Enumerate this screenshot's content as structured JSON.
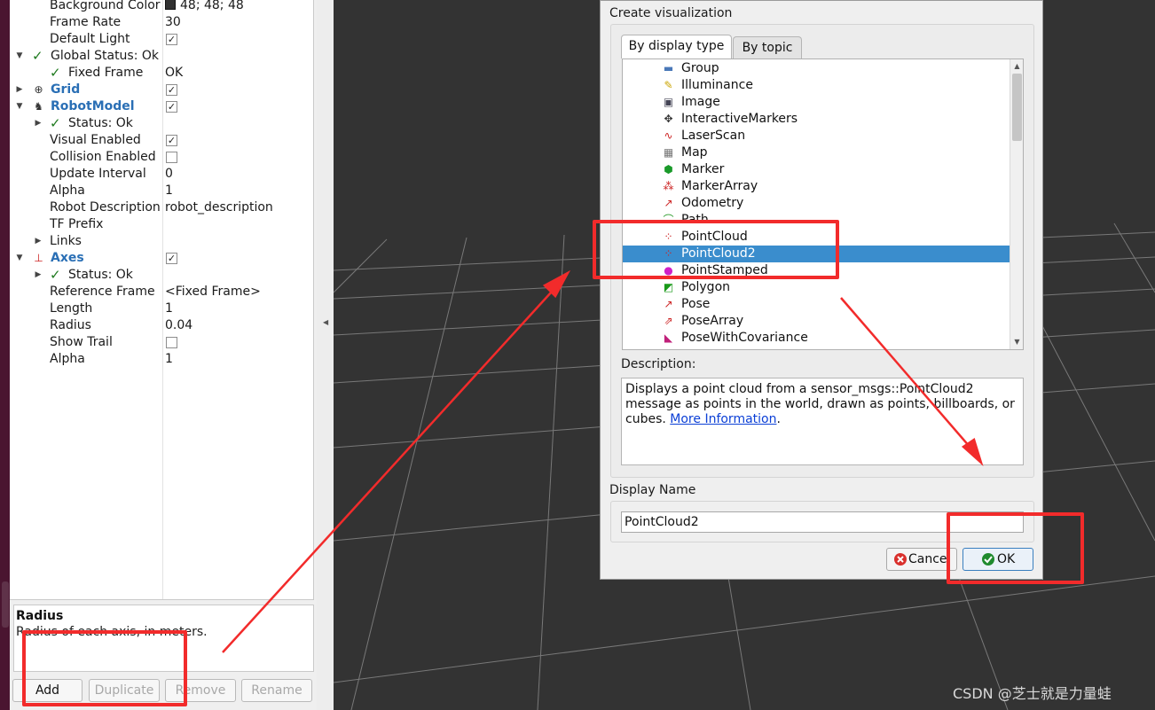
{
  "tree": {
    "rows": [
      {
        "name": "Background Color",
        "value": "48; 48; 48",
        "type": "color"
      },
      {
        "name": "Frame Rate",
        "value": "30",
        "type": "text"
      },
      {
        "name": "Default Light",
        "value": "",
        "type": "checkbox",
        "checked": true
      },
      {
        "name": "Global Status: Ok",
        "value": "",
        "type": "status",
        "expanded": true
      },
      {
        "name": "Fixed Frame",
        "value": "OK",
        "type": "status-child"
      },
      {
        "name": "Grid",
        "value": "",
        "type": "display",
        "checked": true,
        "icon": "grid-icon"
      },
      {
        "name": "RobotModel",
        "value": "",
        "type": "display",
        "checked": true,
        "icon": "robot-model-icon"
      },
      {
        "name": "Status: Ok",
        "value": "",
        "type": "status-child"
      },
      {
        "name": "Visual Enabled",
        "value": "",
        "type": "checkbox",
        "checked": true
      },
      {
        "name": "Collision Enabled",
        "value": "",
        "type": "checkbox",
        "checked": false
      },
      {
        "name": "Update Interval",
        "value": "0",
        "type": "text"
      },
      {
        "name": "Alpha",
        "value": "1",
        "type": "text"
      },
      {
        "name": "Robot Description",
        "value": "robot_description",
        "type": "text"
      },
      {
        "name": "TF Prefix",
        "value": "",
        "type": "text"
      },
      {
        "name": "Links",
        "value": "",
        "type": "collapsed"
      },
      {
        "name": "Axes",
        "value": "",
        "type": "display",
        "checked": true,
        "icon": "axes-icon"
      },
      {
        "name": "Status: Ok",
        "value": "",
        "type": "status-child"
      },
      {
        "name": "Reference Frame",
        "value": "<Fixed Frame>",
        "type": "text"
      },
      {
        "name": "Length",
        "value": "1",
        "type": "text"
      },
      {
        "name": "Radius",
        "value": "0.04",
        "type": "text"
      },
      {
        "name": "Show Trail",
        "value": "",
        "type": "checkbox",
        "checked": false
      },
      {
        "name": "Alpha",
        "value": "1",
        "type": "text"
      }
    ]
  },
  "help": {
    "title": "Radius",
    "text": "Radius of each axis, in meters."
  },
  "bottom_buttons": {
    "add": "Add",
    "duplicate": "Duplicate",
    "remove": "Remove",
    "rename": "Rename"
  },
  "dialog": {
    "section_title": "Create visualization",
    "tabs": [
      "By display type",
      "By topic"
    ],
    "active_tab": "By display type",
    "items": [
      {
        "label": "Group",
        "icon": "folder-icon"
      },
      {
        "label": "Illuminance",
        "icon": "illuminance-icon"
      },
      {
        "label": "Image",
        "icon": "image-icon"
      },
      {
        "label": "InteractiveMarkers",
        "icon": "interactive-markers-icon"
      },
      {
        "label": "LaserScan",
        "icon": "laser-scan-icon"
      },
      {
        "label": "Map",
        "icon": "map-icon"
      },
      {
        "label": "Marker",
        "icon": "marker-icon"
      },
      {
        "label": "MarkerArray",
        "icon": "marker-array-icon"
      },
      {
        "label": "Odometry",
        "icon": "odometry-icon"
      },
      {
        "label": "Path",
        "icon": "path-icon"
      },
      {
        "label": "PointCloud",
        "icon": "point-cloud-icon"
      },
      {
        "label": "PointCloud2",
        "icon": "point-cloud2-icon"
      },
      {
        "label": "PointStamped",
        "icon": "point-stamped-icon"
      },
      {
        "label": "Polygon",
        "icon": "polygon-icon"
      },
      {
        "label": "Pose",
        "icon": "pose-icon"
      },
      {
        "label": "PoseArray",
        "icon": "pose-array-icon"
      },
      {
        "label": "PoseWithCovariance",
        "icon": "pose-covariance-icon"
      }
    ],
    "selected": "PointCloud2",
    "description_label": "Description:",
    "description_text": "Displays a point cloud from a sensor_msgs::PointCloud2 message as points in the world, drawn as points, billboards, or cubes.",
    "description_link": "More Information",
    "description_end": ".",
    "display_name_label": "Display Name",
    "display_name_value": "PointCloud2",
    "cancel": "Cancel",
    "ok": "OK"
  },
  "watermark": "CSDN @芝士就是力量蛙",
  "colors": {
    "annotation_red": "#f22b2b",
    "selection": "#3a8dcd",
    "link": "#0b3fd6",
    "viewport": "#333333"
  }
}
